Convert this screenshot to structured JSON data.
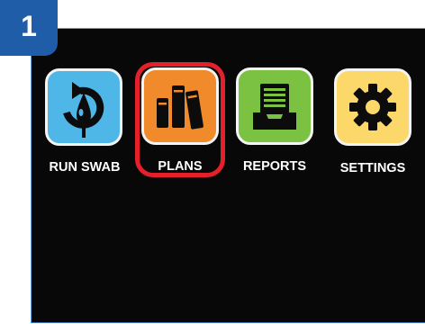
{
  "step": {
    "number": "1"
  },
  "menu": {
    "items": [
      {
        "label": "RUN SWAB",
        "icon": "swab-icon",
        "color": "#4fb6e8"
      },
      {
        "label": "PLANS",
        "icon": "books-icon",
        "color": "#f08a2b"
      },
      {
        "label": "REPORTS",
        "icon": "report-tray-icon",
        "color": "#7cc242"
      },
      {
        "label": "SETTINGS",
        "icon": "gear-icon",
        "color": "#fcd86a"
      }
    ],
    "highlighted": "PLANS"
  },
  "colors": {
    "badge": "#1f5da8",
    "screen": "#080808",
    "highlight": "#e4202a"
  }
}
